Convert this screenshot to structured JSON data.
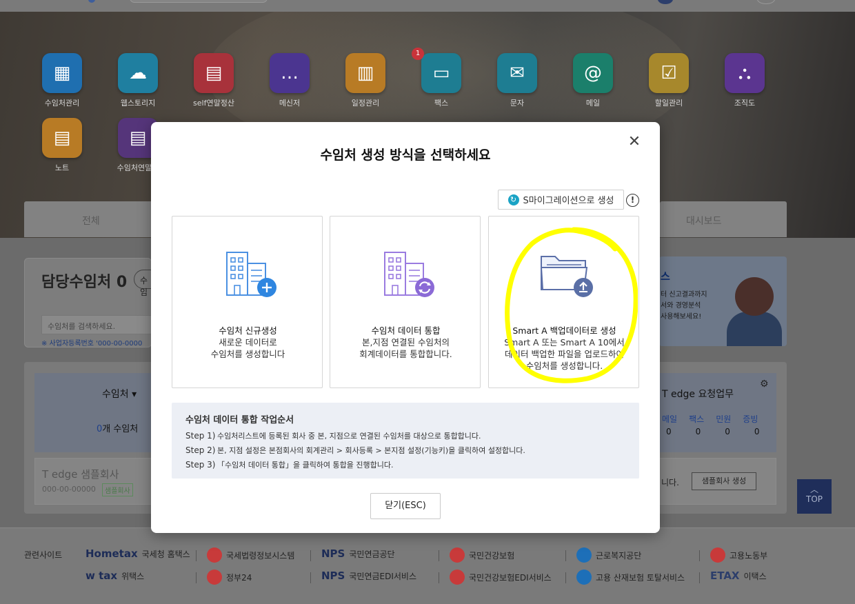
{
  "apps": [
    {
      "label": "수임처관리",
      "icon": "building-icon",
      "color": "#1f6fb0"
    },
    {
      "label": "웹스토리지",
      "icon": "cloud-storage-icon",
      "color": "#1f7fa0"
    },
    {
      "label": "self연말정산",
      "icon": "tax-document-icon",
      "color": "#a8323b"
    },
    {
      "label": "메신저",
      "icon": "chat-bubble-icon",
      "color": "#4b3590"
    },
    {
      "label": "일정관리",
      "icon": "calendar-icon",
      "color": "#b87b25"
    },
    {
      "label": "팩스",
      "icon": "fax-icon",
      "color": "#1e7d92"
    },
    {
      "label": "문자",
      "icon": "sms-icon",
      "color": "#1e7d92"
    },
    {
      "label": "메일",
      "icon": "mail-icon",
      "color": "#1b7f6b"
    },
    {
      "label": "할일관리",
      "icon": "checklist-icon",
      "color": "#a7882c"
    },
    {
      "label": "조직도",
      "icon": "org-chart-icon",
      "color": "#5b3590"
    },
    {
      "label": "노트",
      "icon": "note-icon",
      "color": "#b87b25"
    },
    {
      "label": "수임처연말정",
      "icon": "tax-receipt-icon",
      "color": "#55357a"
    }
  ],
  "fax_badge": "1",
  "tabs": {
    "all": "전체",
    "dashboard": "대시보드"
  },
  "left_panel": {
    "title": "담당수임처 0",
    "chip": "수임",
    "search_placeholder": "수임처를 검색하세요.",
    "note": "※ 사업자등록번호 '000-00-0000"
  },
  "banner": {
    "title": "스",
    "line1": "터 신고결과까지",
    "line2": "서와 경영분석",
    "line3": "사용해보세요!"
  },
  "client_col": {
    "header": "수임처 ▾",
    "count_num": "0",
    "count_text": "개 수임처"
  },
  "sample": {
    "name": "T edge 샘플회사",
    "biz_no": "000-00-00000",
    "tag": "샘플회사"
  },
  "request": {
    "title": "T edge 요청업무",
    "cats": [
      "메일",
      "팩스",
      "민원",
      "증빙"
    ],
    "nums": [
      "0",
      "0",
      "0",
      "0"
    ],
    "suffix": "니다.",
    "sample_btn": "샘플회사 생성"
  },
  "top_label": "TOP",
  "footer": {
    "related": "관련사이트",
    "sites_row1": [
      "국세청 홈택스",
      "국세법령정보시스템",
      "국민연금공단",
      "국민건강보험",
      "근로복지공단",
      "고용노동부"
    ],
    "sites_row2": [
      "위택스",
      "정부24",
      "국민연금EDI서비스",
      "국민건강보험EDI서비스",
      "고용 산재보험 토탈서비스",
      "이택스"
    ],
    "logos": {
      "hometax": "Hometax",
      "wetax": "w tax",
      "nps": "NPS",
      "etax": "ETAX"
    }
  },
  "modal": {
    "title": "수임처 생성 방식을 선택하세요",
    "migration_btn": "S마이그레이션으로 생성",
    "info": "!",
    "close_x": "✕",
    "cards": [
      {
        "title": "수임처 신규생성",
        "desc": [
          "새로운 데이터로",
          "수임처를 생성합니다"
        ]
      },
      {
        "title": "수임처 데이터 통합",
        "desc": [
          "본,지점 연결된 수임처의",
          "회계데이터를 통합합니다."
        ]
      },
      {
        "title": "Smart A 백업데이터로 생성",
        "desc": [
          "Smart A 또는 Smart A 10에서",
          "데이터 백업한 파일을 업로드하여",
          "수임처를 생성합니다."
        ]
      }
    ],
    "guide": {
      "title": "수임처 데이터 통합 작업순서",
      "steps": [
        {
          "k": "Step 1)",
          "v": "수임처리스트에 등록된 회사 중 본, 지점으로 연결된 수임처를 대상으로 통합합니다."
        },
        {
          "k": "Step 2)",
          "v": "본, 지점 설정은 본점회사의 회계관리 > 회사등록 > 본지점 설정(기능키)을 클릭하여 설정합니다."
        },
        {
          "k": "Step 3)",
          "v": "「수임처 데이터 통합」을 클릭하여 통합을 진행합니다."
        }
      ]
    },
    "close_btn": "닫기(ESC)",
    "highlight_color": "#ffff00"
  }
}
